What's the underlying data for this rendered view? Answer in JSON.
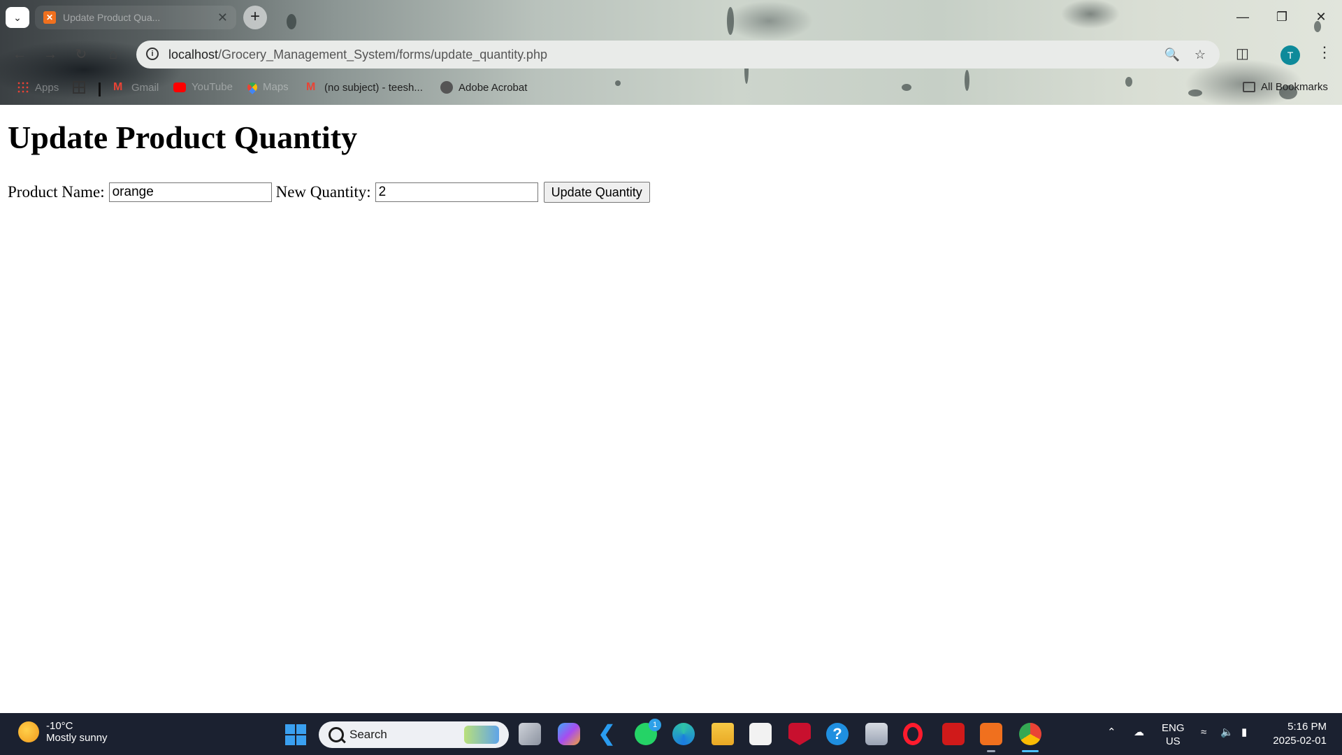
{
  "browser": {
    "tab_title": "Update Product Qua...",
    "new_tab_symbol": "+",
    "url_host": "localhost",
    "url_path": "/Grocery_Management_System/forms/update_quantity.php",
    "avatar_letter": "T",
    "window_controls": {
      "minimize": "—",
      "restore": "❐",
      "close": "✕"
    }
  },
  "bookmarks": {
    "items": [
      {
        "label": "Apps",
        "icon": "apps-grid-icon"
      },
      {
        "label": "",
        "icon": "tab-groups-icon"
      },
      {
        "label": "Gmail",
        "icon": "gmail-icon"
      },
      {
        "label": "YouTube",
        "icon": "youtube-icon"
      },
      {
        "label": "Maps",
        "icon": "maps-icon"
      },
      {
        "label": "(no subject) - teesh...",
        "icon": "gmail-icon"
      },
      {
        "label": "Adobe Acrobat",
        "icon": "globe-icon"
      }
    ],
    "all_bookmarks": "All Bookmarks"
  },
  "page": {
    "heading": "Update Product Quantity",
    "form": {
      "product_label": "Product Name:",
      "product_value": "orange",
      "quantity_label": "New Quantity:",
      "quantity_value": "2",
      "submit_label": "Update Quantity"
    }
  },
  "taskbar": {
    "weather_temp": "-10°C",
    "weather_desc": "Mostly sunny",
    "search_label": "Search",
    "whatsapp_badge": "1",
    "tray_lang": "ENG",
    "tray_region": "US",
    "time": "5:16 PM",
    "date": "2025-02-01",
    "apps": [
      "task-view",
      "copilot",
      "vscode",
      "whatsapp",
      "edge",
      "file-explorer",
      "microsoft-store",
      "mcafee",
      "help",
      "files",
      "opera",
      "acrobat",
      "xampp",
      "chrome"
    ]
  }
}
